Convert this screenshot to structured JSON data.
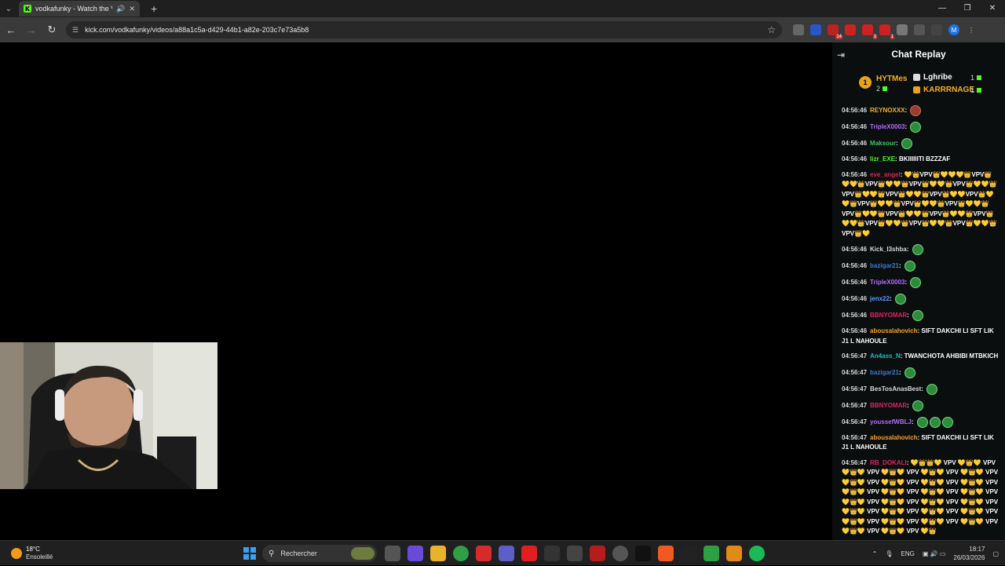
{
  "browser": {
    "tab_title": "vodkafunky - Watch the VO",
    "url": "kick.com/vodkafunky/videos/a88a1c5a-d429-44b1-a82e-203c7e73a5b8",
    "extension_badges": [
      "14",
      "3",
      "1"
    ],
    "profile_initial": "M"
  },
  "chat": {
    "title": "Chat Replay",
    "gifters": [
      {
        "rank": "1",
        "name": "HYTMes",
        "count": "2"
      },
      {
        "name": "Lghribe",
        "count": "1"
      },
      {
        "name": "KARRRNAGE",
        "count": "1"
      }
    ],
    "messages": [
      {
        "time": "04:56:46",
        "user": "REYNOXXX",
        "color": "#f5b01a",
        "text": "",
        "emotes": 1,
        "emote_style": "red"
      },
      {
        "time": "04:56:46",
        "user": "TripleX0003",
        "color": "#b36cff",
        "text": "",
        "emotes": 1
      },
      {
        "time": "04:56:46",
        "user": "Maksour",
        "color": "#3ec46d",
        "text": "",
        "emotes": 1
      },
      {
        "time": "04:56:46",
        "user": "lizr_EXE",
        "color": "#53fc18",
        "text": "BKIIIIIITI BZZZAF",
        "emotes": 0
      },
      {
        "time": "04:56:46",
        "user": "eve_angel",
        "color": "#e0245e",
        "text": "💛👑VPV👑💛💛💛👑VPV👑💛💛👑VPV👑💛💛👑VPV👑💛💛👑VPV👑💛💛👑VPV👑💛💛👑VPV👑💛💛👑VPV👑💛💛VPV👑💛💛👑VPV👑💛💛👑VPV👑💛💛👑VPV👑💛💛👑VPV👑💛💛👑VPV👑💛💛👑VPV👑💛💛👑VPV👑💛💛👑VPV👑💛💛👑VPV👑💛💛👑VPV👑💛💛👑VPV👑💛",
        "emotes": 0
      },
      {
        "time": "04:56:46",
        "user": "Kick_I3shba",
        "color": "#d9d9d9",
        "text": "",
        "emotes": 1
      },
      {
        "time": "04:56:46",
        "user": "bazigar21",
        "color": "#3a7bd5",
        "text": "",
        "emotes": 1
      },
      {
        "time": "04:56:46",
        "user": "TripleX0003",
        "color": "#b36cff",
        "text": "",
        "emotes": 1
      },
      {
        "time": "04:56:46",
        "user": "jenx22",
        "color": "#5b9bff",
        "text": "",
        "emotes": 1
      },
      {
        "time": "04:56:46",
        "user": "BBNYOMAR",
        "color": "#e0245e",
        "text": "",
        "emotes": 1
      },
      {
        "time": "04:56:46",
        "user": "abousalahovich",
        "color": "#f5a623",
        "text": "SIFT DAKCHI LI SFT LIK J1 L NAHOULE",
        "emotes": 0
      },
      {
        "time": "04:56:47",
        "user": "An4ass_N",
        "color": "#1fbfb8",
        "text": "TWANCHOTA AHBIBI MTBKICH",
        "emotes": 0
      },
      {
        "time": "04:56:47",
        "user": "bazigar21",
        "color": "#3a7bd5",
        "text": "",
        "emotes": 1
      },
      {
        "time": "04:56:47",
        "user": "BesTosAnasBest",
        "color": "#d9d9d9",
        "text": "",
        "emotes": 1
      },
      {
        "time": "04:56:47",
        "user": "BBNYOMAR",
        "color": "#e0245e",
        "text": "",
        "emotes": 1
      },
      {
        "time": "04:56:47",
        "user": "youssefWBLJ",
        "color": "#b36cff",
        "text": "",
        "emotes": 3
      },
      {
        "time": "04:56:47",
        "user": "abousalahovich",
        "color": "#f5a623",
        "text": "SIFT DAKCHI LI SFT LIK J1 L NAHOULE",
        "emotes": 0
      },
      {
        "time": "04:56:47",
        "user": "RB_DOKALI",
        "color": "#e0245e",
        "text": "💛👑👑💛 VPV 💛👑💛 VPV 💛👑💛 VPV 💛👑💛 VPV 💛👑💛 VPV 💛👑💛 VPV 💛👑💛 VPV 💛👑💛 VPV 💛👑💛 VPV 💛👑💛 VPV 💛👑💛 VPV 💛👑💛 VPV 💛👑💛 VPV 💛👑💛 VPV 💛👑💛 VPV 💛👑💛 VPV 💛👑💛 VPV 💛👑💛 VPV 💛👑💛 VPV 💛👑💛 VPV 💛👑💛 VPV 💛👑💛 VPV 💛👑💛 VPV 💛👑💛 VPV 💛👑💛 VPV 💛👑💛 VPV 💛👑💛 VPV 💛👑💛 VPV 💛👑",
        "emotes": 0
      }
    ]
  },
  "taskbar": {
    "weather_temp": "18°C",
    "weather_cond": "Ensoleillé",
    "search_placeholder": "Rechercher",
    "lang": "ENG",
    "time": "18:17",
    "date": "26/03/2026"
  }
}
